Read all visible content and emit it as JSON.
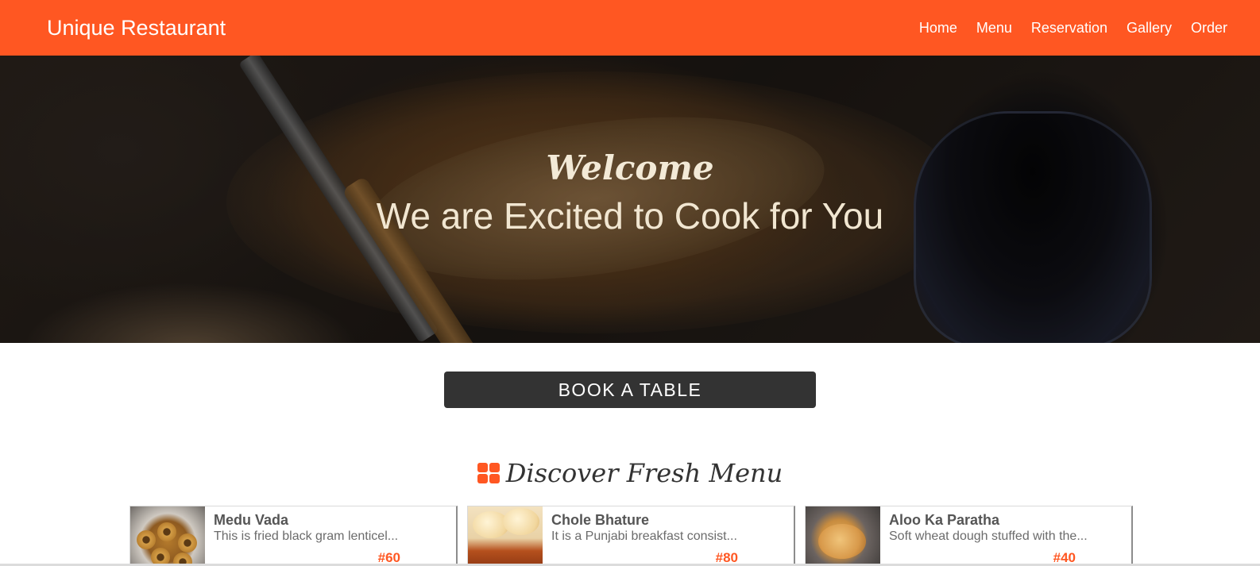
{
  "navbar": {
    "brand": "Unique Restaurant",
    "links": [
      "Home",
      "Menu",
      "Reservation",
      "Gallery",
      "Order"
    ]
  },
  "hero": {
    "welcome": "Welcome",
    "tagline": "We are Excited to Cook for You"
  },
  "cta": {
    "book_label": "BOOK A TABLE"
  },
  "menu_section": {
    "title": "Discover Fresh Menu",
    "items": [
      {
        "name": "Medu Vada",
        "description": "This is fried black gram lenticel...",
        "price": "#60"
      },
      {
        "name": "Chole Bhature",
        "description": "It is a Punjabi breakfast consist...",
        "price": "#80"
      },
      {
        "name": "Aloo Ka Paratha",
        "description": "Soft wheat dough stuffed with the...",
        "price": "#40"
      }
    ]
  },
  "colors": {
    "accent": "#ff5722",
    "button_dark": "#333333"
  },
  "icons": {
    "menu_section_icon": "grid-icon"
  }
}
